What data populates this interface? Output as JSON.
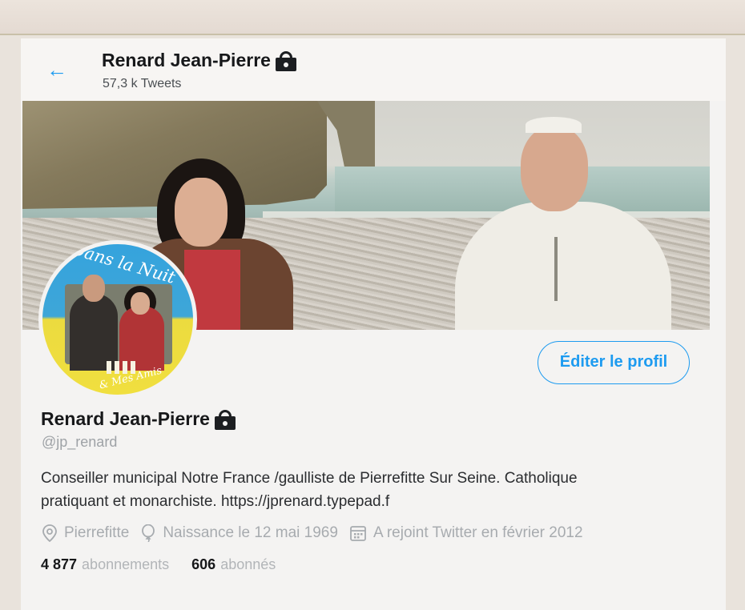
{
  "header": {
    "back_icon": "arrow-left-icon",
    "name": "Renard Jean-Pierre",
    "tweet_count": "57,3 k Tweets",
    "protected_icon": "lock-icon"
  },
  "avatar": {
    "text_top": "Dans la Nuit",
    "text_bottom": "& Mes Amis"
  },
  "actions": {
    "edit_profile_label": "Éditer le profil"
  },
  "profile": {
    "name": "Renard Jean-Pierre",
    "handle": "@jp_renard",
    "bio_line1": "Conseiller municipal Notre France /gaulliste de Pierrefitte Sur Seine. Catholique",
    "bio_line2": "pratiquant et monarchiste. https://jprenard.typepad.f",
    "location": "Pierrefitte",
    "birth": "Naissance le 12 mai 1969",
    "joined": "A rejoint Twitter en février 2012",
    "following_count": "4 877",
    "following_label": "abonnements",
    "followers_count": "606",
    "followers_label": "abonnés"
  },
  "colors": {
    "accent": "#1d9bf0",
    "text_primary": "#17181a",
    "text_secondary": "#a7abaf"
  }
}
